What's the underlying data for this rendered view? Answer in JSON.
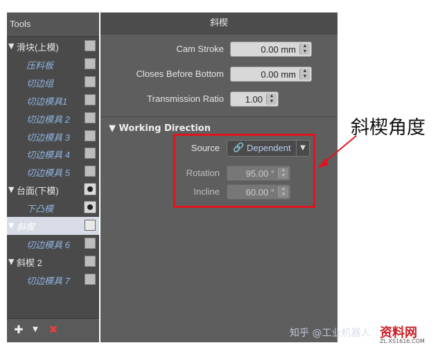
{
  "tools_panel": {
    "title": "Tools",
    "items": [
      {
        "label": "滑块(上模)",
        "kind": "group",
        "control": "checkbox"
      },
      {
        "label": "压料板",
        "kind": "child",
        "control": "checkbox"
      },
      {
        "label": "切边组",
        "kind": "child",
        "control": "checkbox"
      },
      {
        "label": "切边模具1",
        "kind": "child",
        "control": "checkbox"
      },
      {
        "label": "切边模具 2",
        "kind": "child",
        "control": "checkbox"
      },
      {
        "label": "切边模具 3",
        "kind": "child",
        "control": "checkbox"
      },
      {
        "label": "切边模具 4",
        "kind": "child",
        "control": "checkbox"
      },
      {
        "label": "切边模具 5",
        "kind": "child",
        "control": "checkbox"
      },
      {
        "label": "台面(下模)",
        "kind": "group",
        "control": "eye"
      },
      {
        "label": "下凸模",
        "kind": "child",
        "control": "eye"
      },
      {
        "label": "斜楔",
        "kind": "group",
        "control": "checkbox",
        "selected": true
      },
      {
        "label": "切边模具 6",
        "kind": "child",
        "control": "checkbox"
      },
      {
        "label": "斜楔 2",
        "kind": "group",
        "control": "checkbox"
      },
      {
        "label": "切边模具 7",
        "kind": "child",
        "control": "checkbox"
      }
    ],
    "footer": {
      "add_icon": "add-tool-icon",
      "delete_icon": "delete-icon"
    }
  },
  "props_panel": {
    "title": "斜楔",
    "cam_stroke": {
      "label": "Cam Stroke",
      "value": "0.00 mm"
    },
    "closes_before_bottom": {
      "label": "Closes Before Bottom",
      "value": "0.00 mm"
    },
    "transmission_ratio": {
      "label": "Transmission Ratio",
      "value": "1.00"
    },
    "working_direction": {
      "title": "Working Direction",
      "source": {
        "label": "Source",
        "value": "Dependent"
      },
      "rotation": {
        "label": "Rotation",
        "value": "95.00 °"
      },
      "incline": {
        "label": "Incline",
        "value": "60.00 °"
      }
    }
  },
  "annotation": {
    "text": "斜楔角度",
    "color": "#e0141e"
  },
  "watermark": {
    "text": "知乎 @工业机器人",
    "logo": "资料网",
    "logo_sub": "ZL.XS1616.COM"
  }
}
